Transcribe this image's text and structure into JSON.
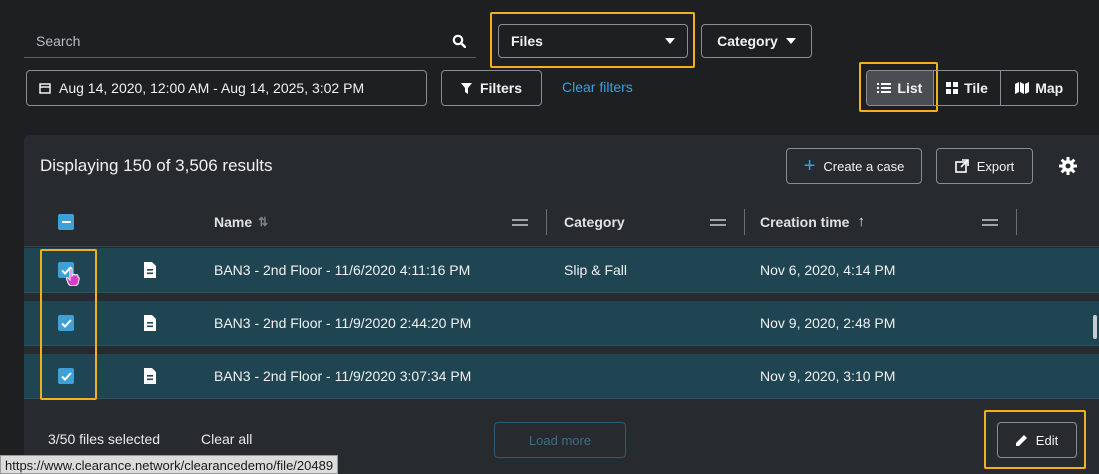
{
  "search": {
    "placeholder": "Search",
    "value": ""
  },
  "type_select": {
    "value": "Files"
  },
  "category_select": {
    "label": "Category"
  },
  "date_range": {
    "label": "Aug 14, 2020, 12:00 AM - Aug 14, 2025, 3:02 PM"
  },
  "filters": {
    "label": "Filters",
    "clear_label": "Clear filters"
  },
  "views": {
    "list": "List",
    "tile": "Tile",
    "map": "Map",
    "active": "list"
  },
  "results": {
    "summary": "Displaying 150 of 3,506 results",
    "create_case": "Create a case",
    "export": "Export"
  },
  "table": {
    "columns": {
      "name": "Name",
      "category": "Category",
      "creation_time": "Creation time"
    },
    "rows": [
      {
        "name": "BAN3 - 2nd Floor - 11/6/2020 4:11:16 PM",
        "category": "Slip & Fall",
        "creation_time": "Nov 6, 2020, 4:14 PM",
        "checked": true
      },
      {
        "name": "BAN3 - 2nd Floor - 11/9/2020 2:44:20 PM",
        "category": "",
        "creation_time": "Nov 9, 2020, 2:48 PM",
        "checked": true
      },
      {
        "name": "BAN3 - 2nd Floor - 11/9/2020 3:07:34 PM",
        "category": "",
        "creation_time": "Nov 9, 2020, 3:10 PM",
        "checked": true
      }
    ]
  },
  "footer": {
    "selected": "3/50 files selected",
    "clear_all": "Clear all",
    "load_more": "Load more",
    "edit": "Edit"
  },
  "status_url": "https://www.clearance.network/clearancedemo/file/20489",
  "colors": {
    "accent": "#3ea0d8",
    "highlight": "#f2b01e",
    "row_selected": "#1f4452",
    "link": "#3ea0d8"
  }
}
